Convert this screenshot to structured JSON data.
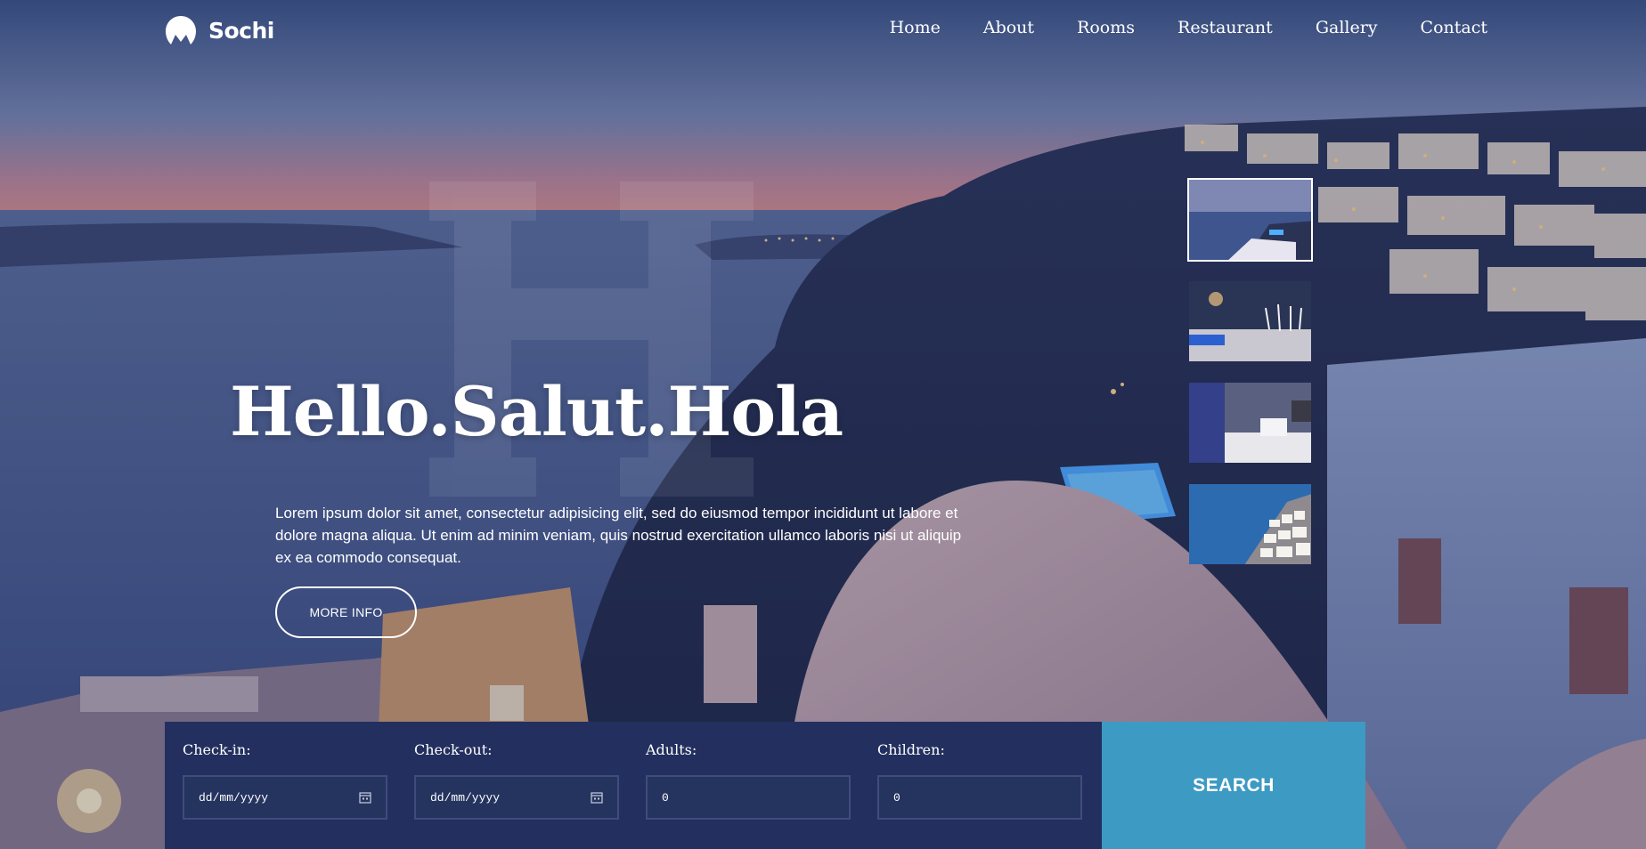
{
  "brand": {
    "name": "Sochi",
    "logo_icon": "mountain-logo-icon"
  },
  "nav": {
    "items": [
      {
        "label": "Home"
      },
      {
        "label": "About"
      },
      {
        "label": "Rooms"
      },
      {
        "label": "Restaurant"
      },
      {
        "label": "Gallery"
      },
      {
        "label": "Contact"
      }
    ]
  },
  "hero": {
    "headline": "Hello.Salut.Hola",
    "description": "Lorem ipsum dolor sit amet, consectetur adipisicing elit, sed do eiusmod tempor incididunt ut labore et dolore magna aliqua. Ut enim ad minim veniam, quis nostrud exercitation ullamco laboris nisi ut aliquip ex ea commodo consequat.",
    "more_label": "MORE INFO"
  },
  "thumbnails": [
    {
      "name": "coast-sunset-thumb",
      "active": true
    },
    {
      "name": "restaurant-glasses-thumb",
      "active": false
    },
    {
      "name": "hotel-room-thumb",
      "active": false
    },
    {
      "name": "seaside-village-thumb",
      "active": false
    }
  ],
  "booking": {
    "checkin": {
      "label": "Check-in:",
      "value": "dd/mm/yyyy"
    },
    "checkout": {
      "label": "Check-out:",
      "value": "dd/mm/yyyy"
    },
    "adults": {
      "label": "Adults:",
      "value": "0"
    },
    "children": {
      "label": "Children:",
      "value": "0"
    },
    "search_label": "SEARCH"
  },
  "colors": {
    "booking_bg": "#23305f",
    "search_button": "#3d9ac3",
    "field_border": "#3e4d7d"
  }
}
